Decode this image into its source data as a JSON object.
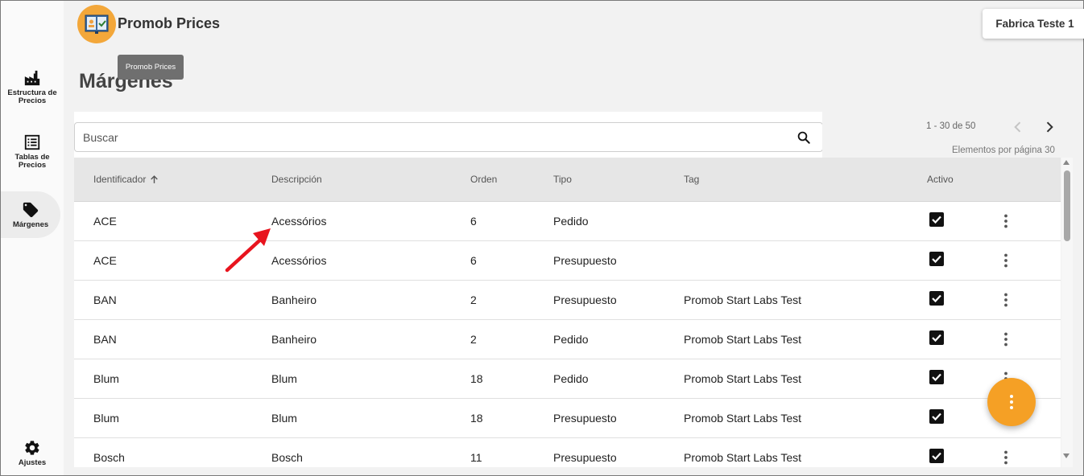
{
  "app": {
    "title": "Promob Prices",
    "tooltip": "Promob Prices"
  },
  "header": {
    "factory_label": "Fabrica Teste 1"
  },
  "sidebar": {
    "items": [
      {
        "label": "Estructura de Precios",
        "icon": "factory-icon"
      },
      {
        "label": "Tablas de Precios",
        "icon": "list-icon"
      },
      {
        "label": "Márgenes",
        "icon": "tag-icon",
        "active": true
      },
      {
        "label": "Ajustes",
        "icon": "gear-icon"
      }
    ]
  },
  "page": {
    "title": "Márgenes"
  },
  "search": {
    "placeholder": "Buscar",
    "value": ""
  },
  "pagination": {
    "range": "1 - 30 de 50",
    "per_page": "Elementos por página 30"
  },
  "table": {
    "columns": [
      "Identificador",
      "Descripción",
      "Orden",
      "Tipo",
      "Tag",
      "Activo"
    ],
    "sort": {
      "column": "Identificador",
      "direction": "asc"
    },
    "rows": [
      {
        "id": "ACE",
        "desc": "Acessórios",
        "order": "6",
        "type": "Pedido",
        "tag": "",
        "active": true
      },
      {
        "id": "ACE",
        "desc": "Acessórios",
        "order": "6",
        "type": "Presupuesto",
        "tag": "",
        "active": true
      },
      {
        "id": "BAN",
        "desc": "Banheiro",
        "order": "2",
        "type": "Presupuesto",
        "tag": "Promob Start Labs Test",
        "active": true
      },
      {
        "id": "BAN",
        "desc": "Banheiro",
        "order": "2",
        "type": "Pedido",
        "tag": "Promob Start Labs Test",
        "active": true
      },
      {
        "id": "Blum",
        "desc": "Blum",
        "order": "18",
        "type": "Pedido",
        "tag": "Promob Start Labs Test",
        "active": true
      },
      {
        "id": "Blum",
        "desc": "Blum",
        "order": "18",
        "type": "Presupuesto",
        "tag": "Promob Start Labs Test",
        "active": true
      },
      {
        "id": "Bosch",
        "desc": "Bosch",
        "order": "11",
        "type": "Presupuesto",
        "tag": "Promob Start Labs Test",
        "active": true
      }
    ]
  },
  "colors": {
    "accent": "#f5a025",
    "logo": "#f3a73a",
    "annotation_arrow": "#e8141e"
  }
}
